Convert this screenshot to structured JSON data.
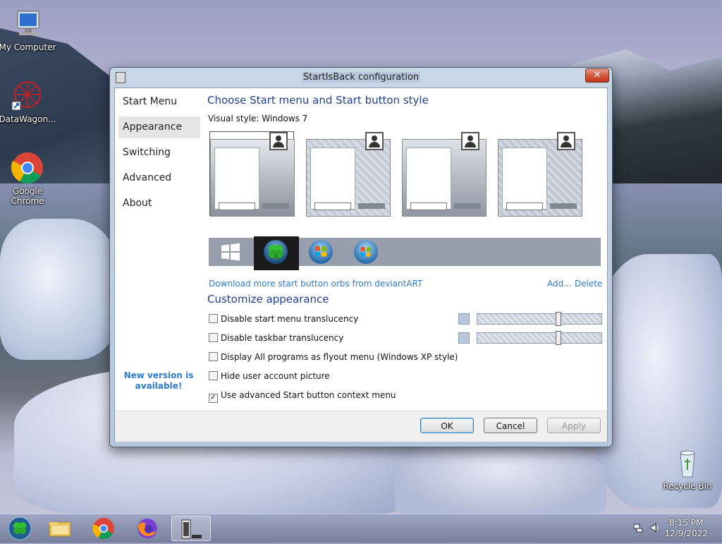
{
  "desktop": {
    "icons": [
      {
        "label": "My Computer"
      },
      {
        "label": "DataWagon..."
      },
      {
        "label": "Google Chrome"
      },
      {
        "label": "Recycle Bin"
      }
    ]
  },
  "window": {
    "title": "StartIsBack configuration",
    "close_glyph": "✕",
    "sidebar": {
      "items": [
        {
          "label": "Start Menu"
        },
        {
          "label": "Appearance"
        },
        {
          "label": "Switching"
        },
        {
          "label": "Advanced"
        },
        {
          "label": "About"
        }
      ],
      "active": "Appearance",
      "new_version": "New version is available!"
    },
    "main": {
      "heading": "Choose Start menu and Start button style",
      "visual_style_label": "Visual style:",
      "visual_style_value": "Windows 7",
      "download_link": "Download more start button orbs from deviantART",
      "add_link": "Add...",
      "delete_link": "Delete",
      "customize_heading": "Customize appearance",
      "checkboxes": [
        {
          "label": "Disable start menu translucency",
          "checked": false
        },
        {
          "label": "Disable taskbar translucency",
          "checked": false
        },
        {
          "label": "Display All programs as flyout menu (Windows XP style)",
          "checked": false
        },
        {
          "label": "Hide user account picture",
          "checked": false
        },
        {
          "label": "Use advanced Start button context menu",
          "checked": true
        }
      ],
      "sliders": [
        {
          "level": 0.66
        },
        {
          "level": 0.66
        }
      ]
    },
    "buttons": {
      "ok": "OK",
      "cancel": "Cancel",
      "apply": "Apply"
    }
  },
  "taskbar": {
    "clock_time": "8:15 PM",
    "clock_date": "12/9/2022"
  },
  "colors": {
    "accent_heading": "#1f3f8f",
    "link": "#2e7bcf"
  }
}
